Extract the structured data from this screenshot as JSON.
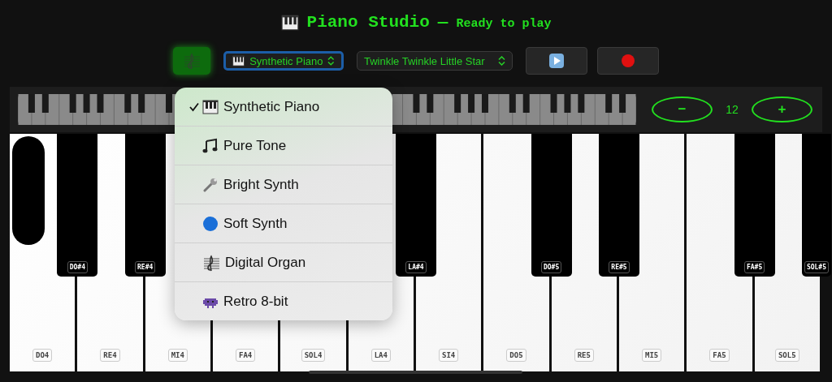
{
  "header": {
    "title": "Piano Studio",
    "separator": "—",
    "status": "Ready to play"
  },
  "toolbar": {
    "score_button": {
      "on": true
    },
    "instrument_select": {
      "value": "Synthetic Piano",
      "focused": true
    },
    "song_select": {
      "value": "Twinkle Twinkle Little Star",
      "focused": false
    }
  },
  "zoom": {
    "minus": "−",
    "value": "12",
    "plus": "+"
  },
  "instrument_menu": [
    {
      "label": "Synthetic Piano",
      "selected": true
    },
    {
      "label": "Pure Tone",
      "selected": false
    },
    {
      "label": "Bright Synth",
      "selected": false
    },
    {
      "label": "Soft Synth",
      "selected": false
    },
    {
      "label": "Digital Organ",
      "selected": false
    },
    {
      "label": "Retro 8-bit",
      "selected": false
    }
  ],
  "white_keys": [
    {
      "label": "DO4",
      "sharp": "DO#4"
    },
    {
      "label": "RE4",
      "sharp": "RE#4"
    },
    {
      "label": "MI4"
    },
    {
      "label": "FA4"
    },
    {
      "label": "SOL4"
    },
    {
      "label": "LA4",
      "sharp": "LA#4"
    },
    {
      "label": "SI4"
    },
    {
      "label": "DO5",
      "sharp": "DO#5"
    },
    {
      "label": "RE5",
      "sharp": "RE#5"
    },
    {
      "label": "MI5"
    },
    {
      "label": "FA5",
      "sharp": "FA#5"
    },
    {
      "label": "SOL5",
      "sharp": "SOL#5"
    }
  ]
}
